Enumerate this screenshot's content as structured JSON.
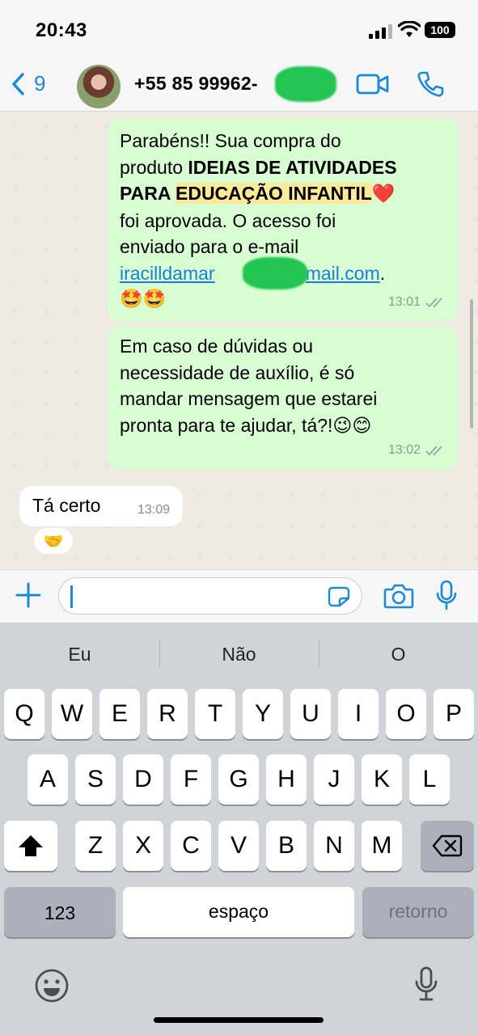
{
  "status": {
    "time": "20:43",
    "battery": "100"
  },
  "header": {
    "back_count": "9",
    "contact_name": "+55 85 99962-"
  },
  "messages": {
    "m1": {
      "line1": "Parabéns!! Sua compra do",
      "line2a": "produto ",
      "line2b": "IDEIAS DE ATIVIDADES",
      "line3a": "PARA ",
      "line3b": "EDUCAÇÃO INFANTIL",
      "line3c": "❤️",
      "line4": "foi aprovada. O acesso foi",
      "line5": "enviado para o e-mail",
      "email_a": "iracilldamar",
      "email_b": "@gmail.com",
      "email_end": ".",
      "line7": "🤩🤩",
      "time": "13:01"
    },
    "m2": {
      "line1": "Em caso de dúvidas ou",
      "line2": "necessidade de auxílio, é só",
      "line3": "mandar mensagem que estarei",
      "line4": "pronta para te ajudar, tá?!😉😊",
      "time": "13:02"
    },
    "m3": {
      "text": "Tá certo",
      "time": "13:09",
      "reaction": "🤝"
    }
  },
  "input": {
    "placeholder": ""
  },
  "keyboard": {
    "suggestions": [
      "Eu",
      "Não",
      "O"
    ],
    "row1": [
      "Q",
      "W",
      "E",
      "R",
      "T",
      "Y",
      "U",
      "I",
      "O",
      "P"
    ],
    "row2": [
      "A",
      "S",
      "D",
      "F",
      "G",
      "H",
      "J",
      "K",
      "L"
    ],
    "row3": [
      "Z",
      "X",
      "C",
      "V",
      "B",
      "N",
      "M"
    ],
    "numbers_label": "123",
    "space_label": "espaço",
    "return_label": "retorno"
  },
  "colors": {
    "accent": "#1a8ad6",
    "outgoing_bubble": "#d9fdd3",
    "chat_bg": "#efeae2",
    "highlight": "#fde99a",
    "link": "#1a7fd4"
  },
  "icons": [
    "back-chevron-icon",
    "video-call-icon",
    "phone-call-icon",
    "plus-icon",
    "sticker-icon",
    "camera-icon",
    "microphone-icon",
    "shift-icon",
    "backspace-icon",
    "emoji-icon",
    "dictation-mic-icon",
    "double-check-icon"
  ]
}
